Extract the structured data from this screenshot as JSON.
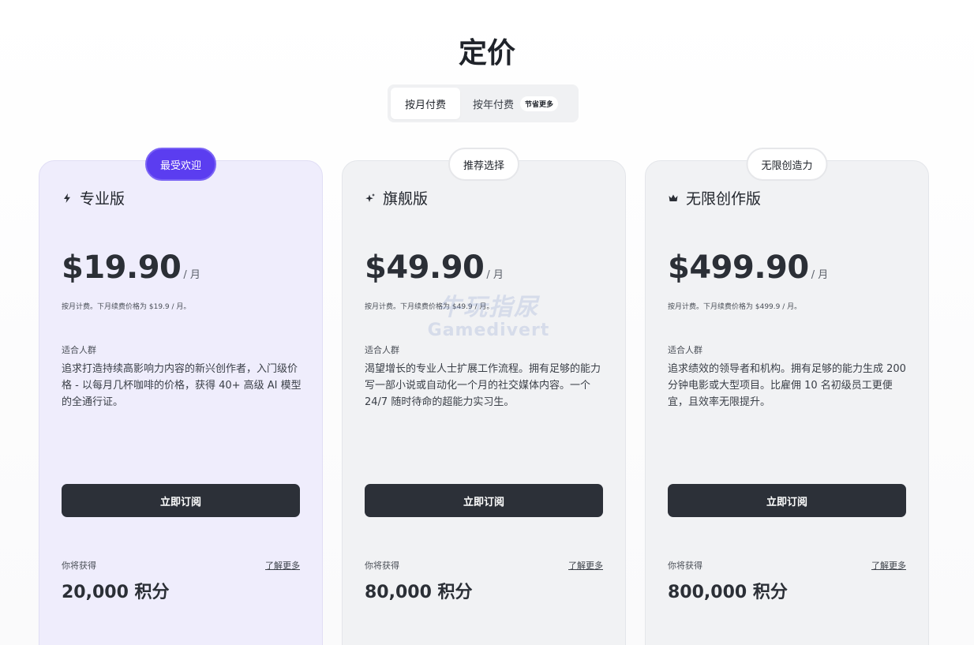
{
  "page": {
    "title": "定价"
  },
  "billing": {
    "monthly_label": "按月付费",
    "yearly_label": "按年付费",
    "save_badge": "节省更多",
    "selected": "monthly"
  },
  "plans": [
    {
      "badge": "最受欢迎",
      "icon": "bolt-icon",
      "name": "专业版",
      "price": "$19.90",
      "period": "/ 月",
      "renew_note": "按月计费。下月续费价格为 $19.9 / 月。",
      "audience_label": "适合人群",
      "audience_desc": "追求打造持续高影响力内容的新兴创作者，入门级价格 - 以每月几杯咖啡的价格，获得 40+ 高级 AI 模型的全通行证。",
      "cta": "立即订阅",
      "earn_label": "你将获得",
      "learn_more": "了解更多",
      "credits": "20,000 积分"
    },
    {
      "badge": "推荐选择",
      "icon": "sparkle-icon",
      "name": "旗舰版",
      "price": "$49.90",
      "period": "/ 月",
      "renew_note": "按月计费。下月续费价格为 $49.9 / 月。",
      "audience_label": "适合人群",
      "audience_desc": "渴望增长的专业人士扩展工作流程。拥有足够的能力写一部小说或自动化一个月的社交媒体内容。一个 24/7 随时待命的超能力实习生。",
      "cta": "立即订阅",
      "earn_label": "你将获得",
      "learn_more": "了解更多",
      "credits": "80,000 积分"
    },
    {
      "badge": "无限创造力",
      "icon": "crown-icon",
      "name": "无限创作版",
      "price": "$499.90",
      "period": "/ 月",
      "renew_note": "按月计费。下月续费价格为 $499.9 / 月。",
      "audience_label": "适合人群",
      "audience_desc": "追求绩效的领导者和机构。拥有足够的能力生成 200 分钟电影或大型项目。比雇佣 10 名初级员工更便宜，且效率无限提升。",
      "cta": "立即订阅",
      "earn_label": "你将获得",
      "learn_more": "了解更多",
      "credits": "800,000 积分"
    }
  ],
  "watermark": {
    "line1": "牛玩指尿",
    "line2": "Gamedivert"
  },
  "colors": {
    "accent": "#5b3df0",
    "button": "#2c3038",
    "featured_card": "#efedfc",
    "card": "#f1f2f4"
  }
}
